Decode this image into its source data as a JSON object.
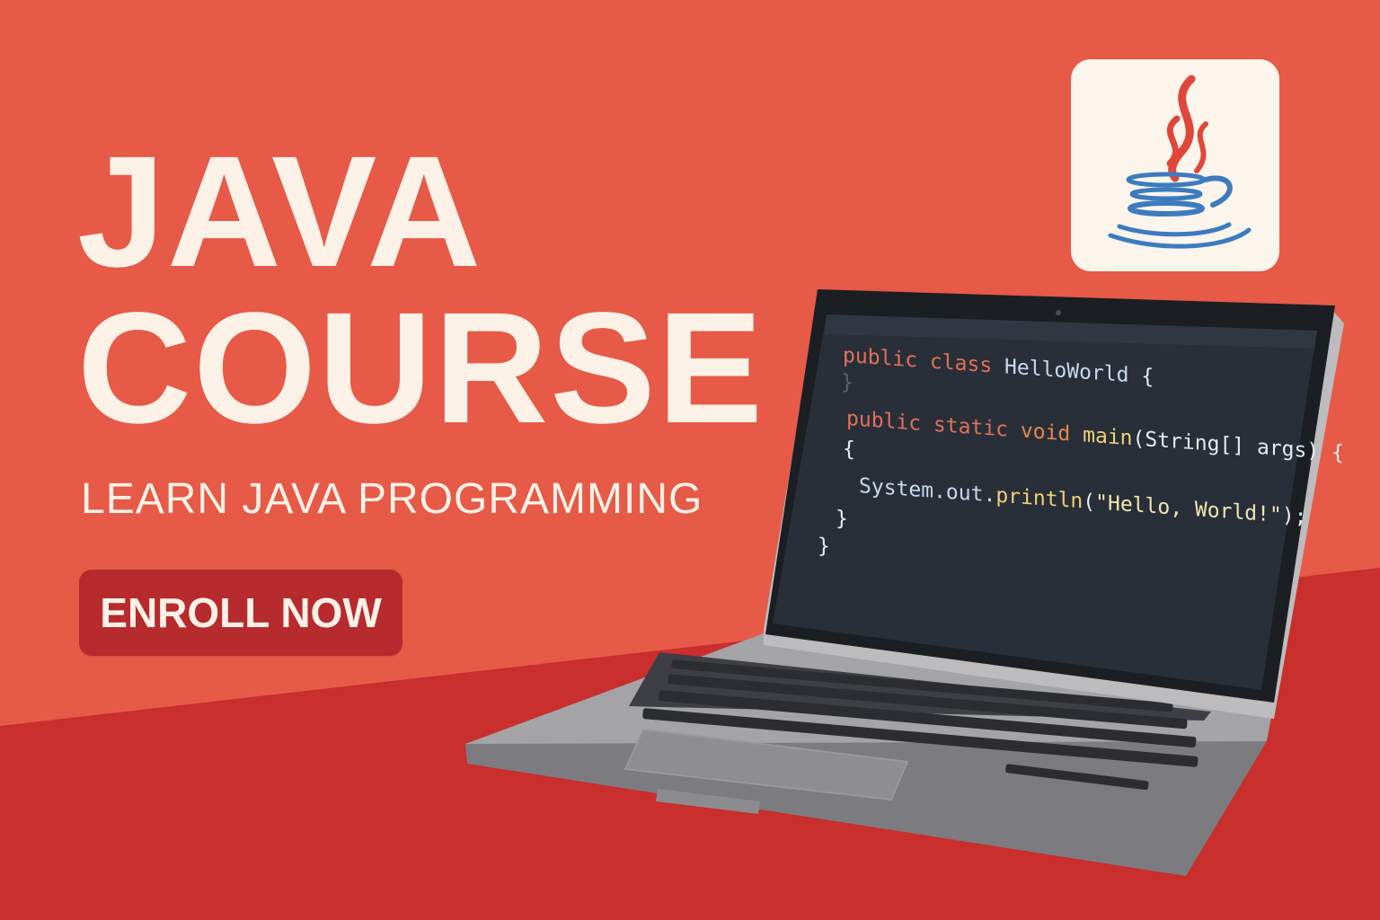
{
  "headline": {
    "line1": "JAVA",
    "line2": "COURSE"
  },
  "subtitle": "LEARN JAVA PROGRAMMING",
  "cta": {
    "label": "ENROLL NOW"
  },
  "logo": {
    "icon": "java-coffee-cup-icon"
  },
  "code": {
    "l1_kw": "public class ",
    "l1_name": "HelloWorld",
    "l1_brace": " {",
    "l2": "}",
    "l3_kw": "public static ",
    "l3_type": "void ",
    "l3_fn": "main",
    "l3_args": "(String[] args) {",
    "l4": "{",
    "l5_obj": "System.out.",
    "l5_fn": "println",
    "l5_open": "(",
    "l5_str": "\"Hello, World!\"",
    "l5_close": ");",
    "l6": "}",
    "l7": "}"
  },
  "colors": {
    "background_top": "#e65a47",
    "background_bottom": "#c92f2c",
    "text_light": "#fbf1e6",
    "button": "#b72a2d",
    "java_red": "#e0473a",
    "java_blue": "#3d7bbf",
    "screen": "#282f38",
    "laptop_body": "#a4a4a6"
  }
}
